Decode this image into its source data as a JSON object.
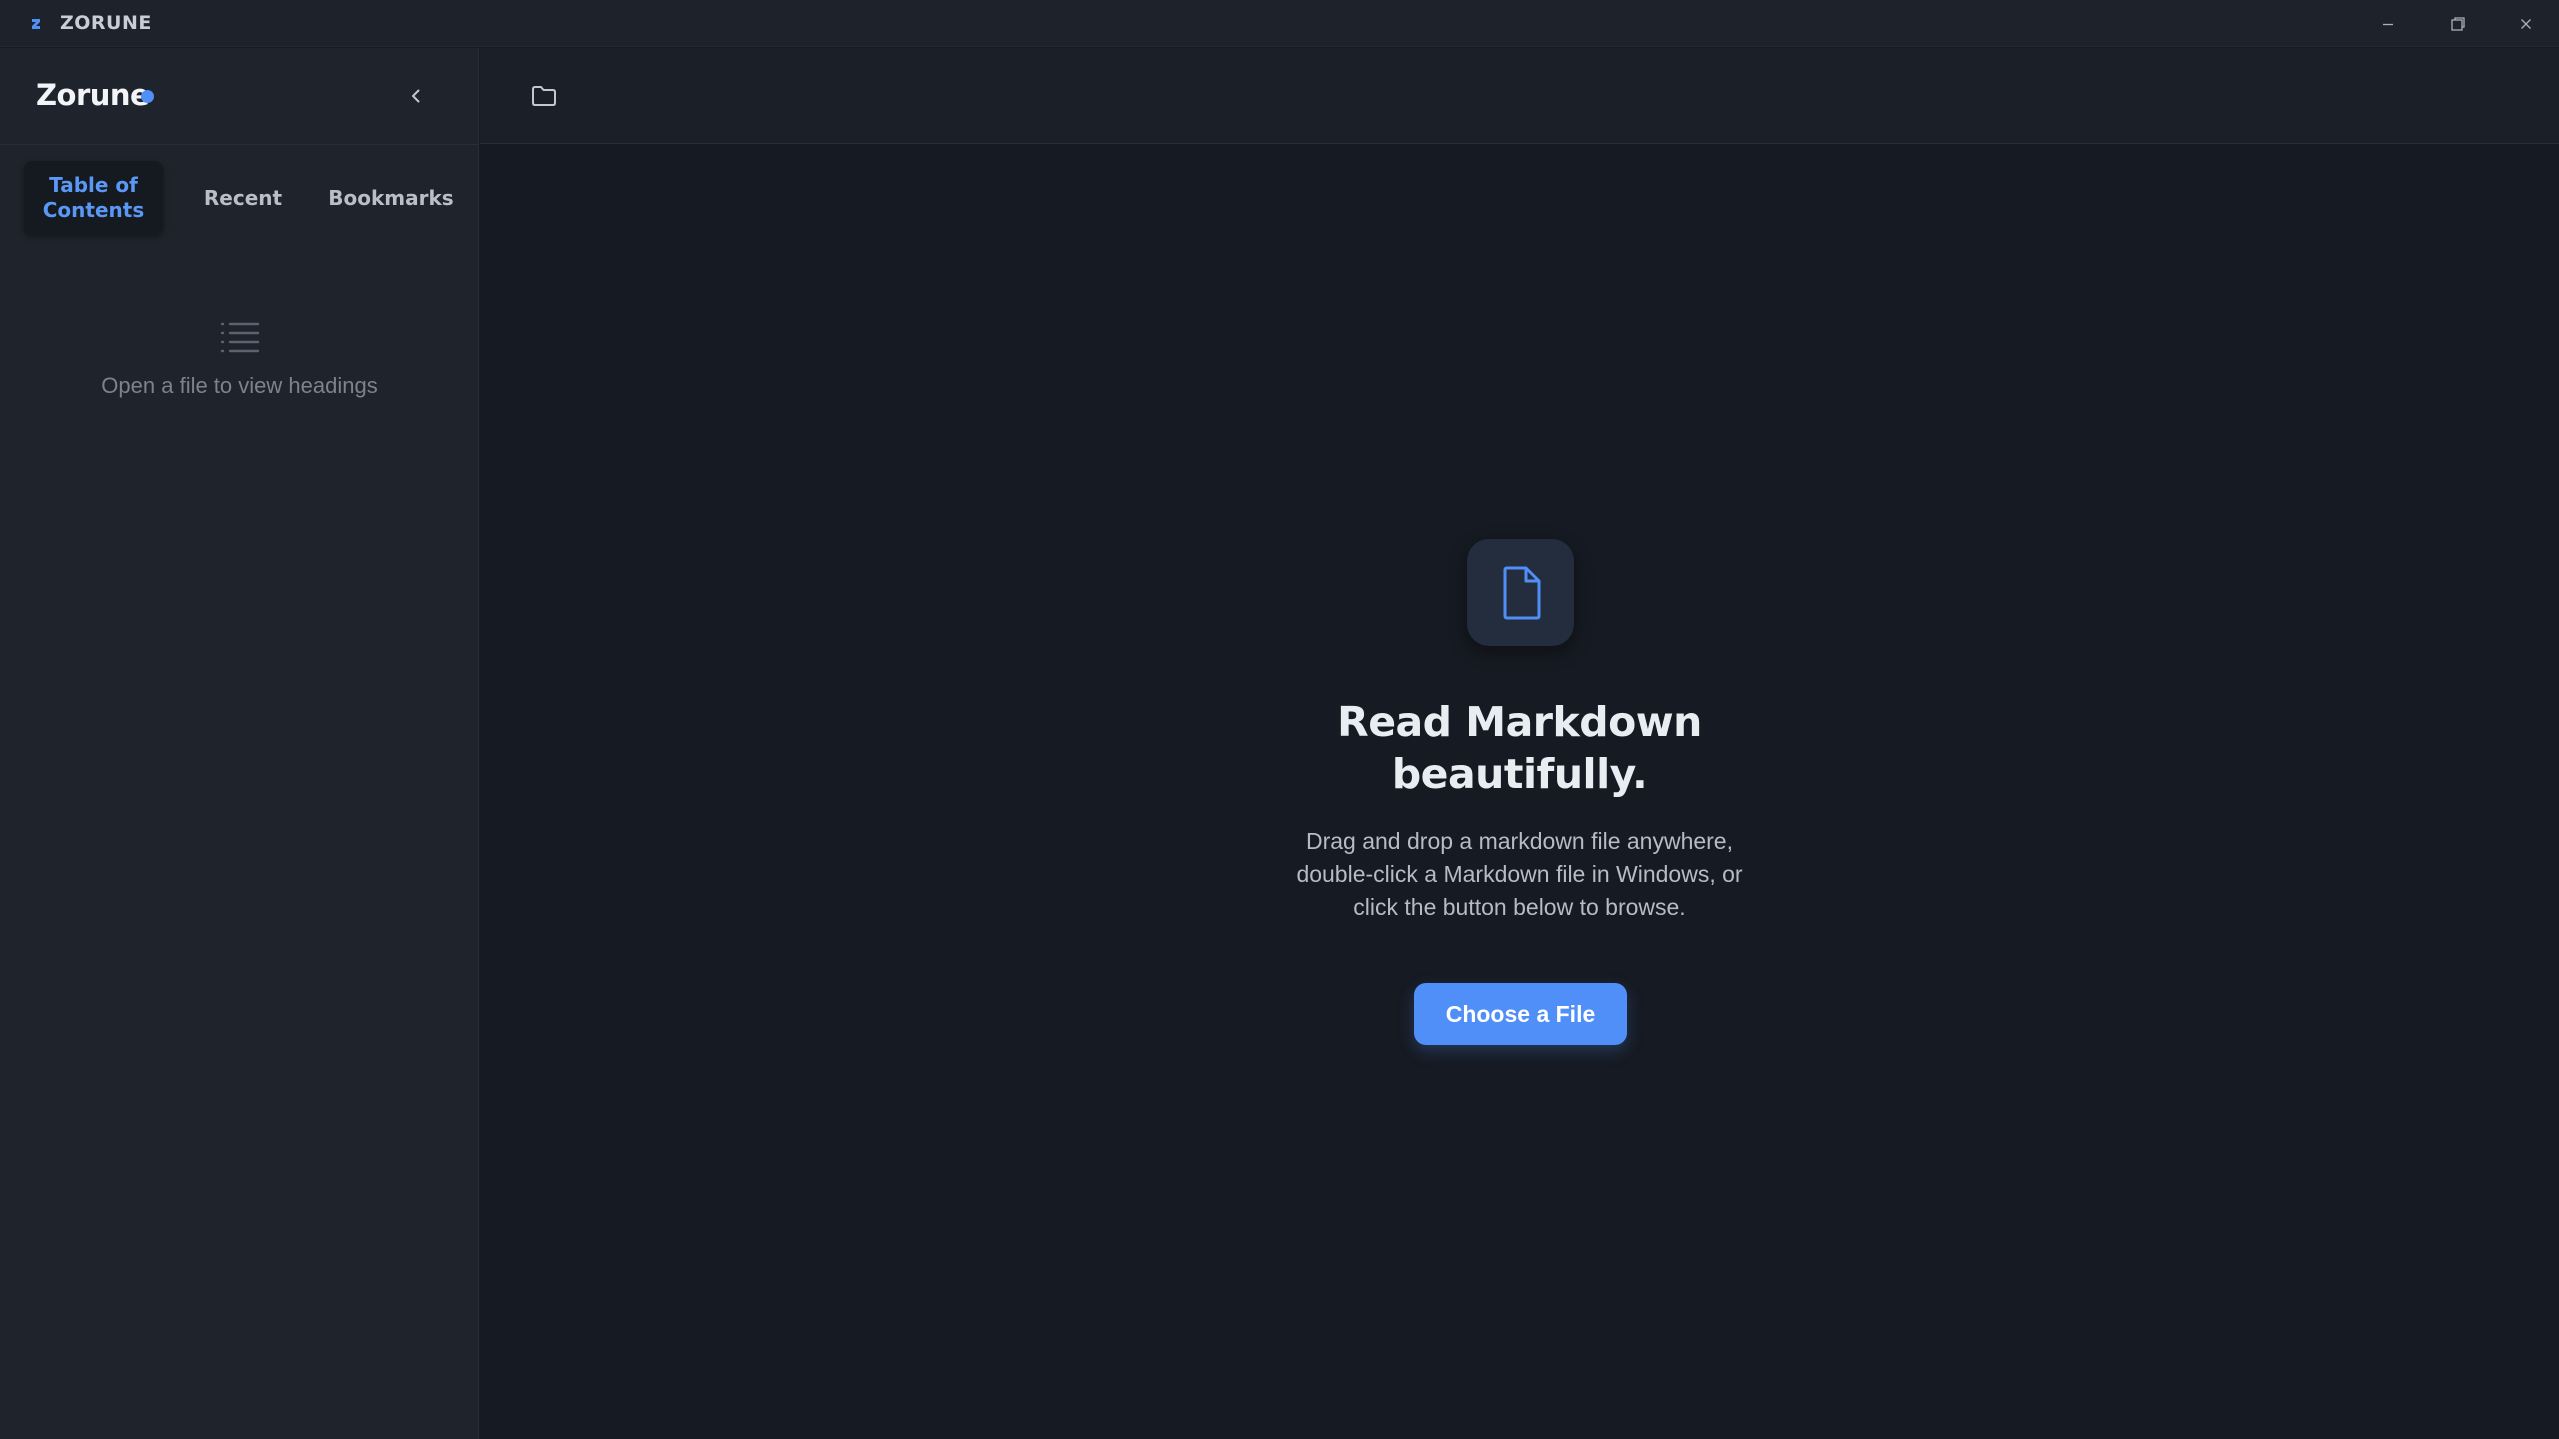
{
  "window": {
    "title": "ZORUNE",
    "controls": [
      "minimize",
      "restore",
      "close"
    ]
  },
  "sidebar": {
    "brand": "Zorune",
    "collapse_icon": "chevron-left-icon",
    "tabs": [
      {
        "label_line1": "Table of",
        "label_line2": "Contents",
        "active": true
      },
      {
        "label": "Recent",
        "active": false
      },
      {
        "label": "Bookmarks",
        "active": false
      }
    ],
    "empty_state": {
      "icon": "list-icon",
      "text": "Open a file to view headings"
    }
  },
  "toolbar": {
    "open_folder_icon": "folder-icon"
  },
  "main": {
    "icon": "file-icon",
    "headline_line1": "Read Markdown",
    "headline_line2": "beautifully.",
    "subtext_line1": "Drag and drop a markdown file anywhere,",
    "subtext_line2": "double-click a Markdown file in Windows, or",
    "subtext_line3": "click the button below to browse.",
    "button_label": "Choose a File"
  },
  "colors": {
    "accent": "#4f8ff7",
    "background": "#161a22",
    "sidebar": "#1f232b"
  }
}
